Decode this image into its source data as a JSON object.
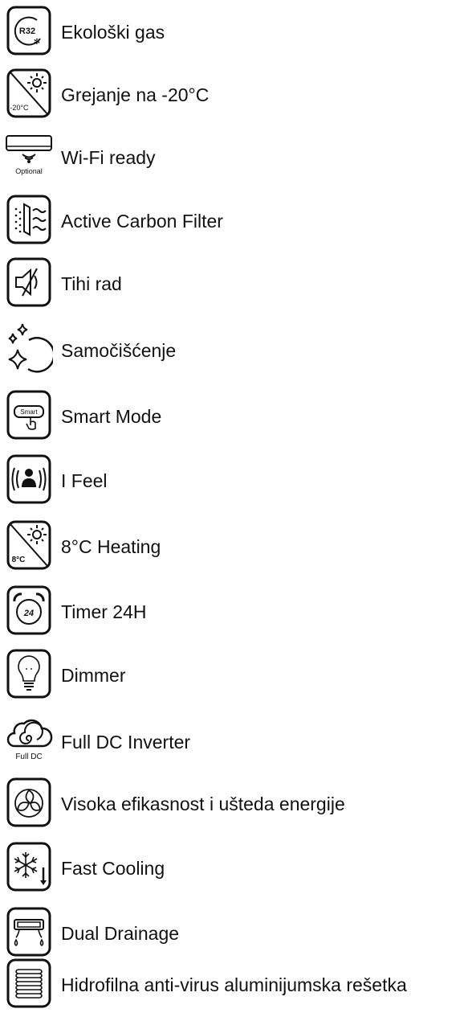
{
  "features": [
    {
      "label": "Ekološki gas",
      "icon": "r32-refrigerant-icon",
      "icon_text": "R32"
    },
    {
      "label": "Grejanje na -20°C",
      "icon": "heating-minus-20-icon",
      "icon_text": "-20°C"
    },
    {
      "label": "Wi-Fi ready",
      "icon": "wifi-indoor-unit-icon",
      "icon_text": "Optional"
    },
    {
      "label": "Active Carbon Filter",
      "icon": "carbon-filter-icon"
    },
    {
      "label": "Tihi rad",
      "icon": "mute-speaker-icon"
    },
    {
      "label": "Samočišćenje",
      "icon": "self-clean-sparkle-icon"
    },
    {
      "label": "Smart Mode",
      "icon": "smart-button-icon",
      "icon_text": "Smart"
    },
    {
      "label": "I Feel",
      "icon": "i-feel-person-icon"
    },
    {
      "label": "8°C Heating",
      "icon": "heating-8c-icon",
      "icon_text": "8°C"
    },
    {
      "label": "Timer 24H",
      "icon": "alarm-clock-icon",
      "icon_text": "24"
    },
    {
      "label": "Dimmer",
      "icon": "light-bulb-icon"
    },
    {
      "label": "Full DC Inverter",
      "icon": "full-dc-cloud-icon",
      "icon_text": "Full DC"
    },
    {
      "label": "Visoka efikasnost i ušteda energije",
      "icon": "eco-leaves-icon"
    },
    {
      "label": "Fast Cooling",
      "icon": "snowflake-down-icon"
    },
    {
      "label": "Dual Drainage",
      "icon": "dual-drainage-icon"
    },
    {
      "label": "Hidrofilna anti-virus aluminijumska rešetka",
      "icon": "aluminium-fins-icon"
    }
  ]
}
